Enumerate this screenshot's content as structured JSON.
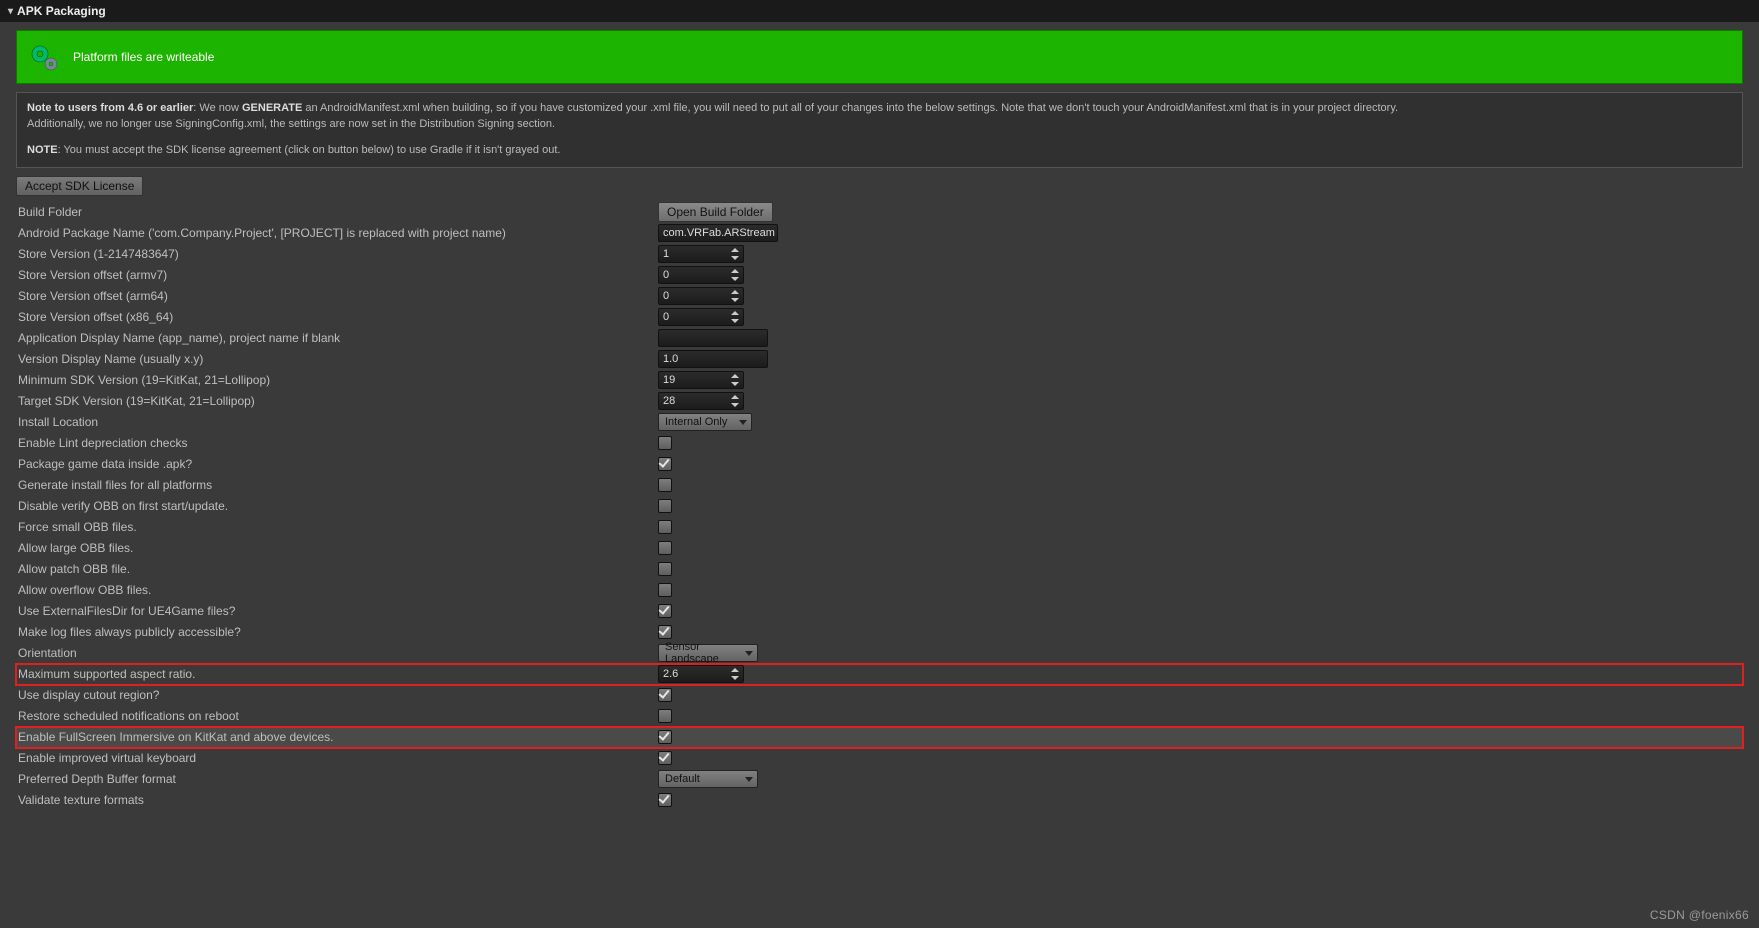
{
  "header": {
    "title": "APK Packaging"
  },
  "banner": {
    "msg": "Platform files are writeable"
  },
  "note": {
    "line1_strong": "Note to users from 4.6 or earlier",
    "line1_mid": ": We now ",
    "line1_gen": "GENERATE",
    "line1_rest": " an AndroidManifest.xml when building, so if you have customized your .xml file, you will need to put all of your changes into the below settings. Note that we don't touch your AndroidManifest.xml that is in your project directory.",
    "line2": "Additionally, we no longer use SigningConfig.xml, the settings are now set in the Distribution Signing section.",
    "line3_strong": "NOTE",
    "line3_rest": ": You must accept the SDK license agreement (click on button below) to use Gradle if it isn't grayed out."
  },
  "buttons": {
    "accept_sdk": "Accept SDK License",
    "open_build_folder": "Open Build Folder"
  },
  "fields": {
    "build_folder": "Build Folder",
    "pkg_name_label": "Android Package Name ('com.Company.Project', [PROJECT] is replaced with project name)",
    "pkg_name_value": "com.VRFab.ARStream",
    "store_ver_label": "Store Version (1-2147483647)",
    "store_ver_value": "1",
    "store_off_armv7_label": "Store Version offset (armv7)",
    "store_off_armv7_value": "0",
    "store_off_arm64_label": "Store Version offset (arm64)",
    "store_off_arm64_value": "0",
    "store_off_x86_64_label": "Store Version offset (x86_64)",
    "store_off_x86_64_value": "0",
    "app_display_label": "Application Display Name (app_name), project name if blank",
    "app_display_value": "",
    "ver_display_label": "Version Display Name (usually x.y)",
    "ver_display_value": "1.0",
    "min_sdk_label": "Minimum SDK Version (19=KitKat, 21=Lollipop)",
    "min_sdk_value": "19",
    "target_sdk_label": "Target SDK Version (19=KitKat, 21=Lollipop)",
    "target_sdk_value": "28",
    "install_loc_label": "Install Location",
    "install_loc_value": "Internal Only",
    "lint_label": "Enable Lint depreciation checks",
    "pack_apk_label": "Package game data inside .apk?",
    "gen_install_label": "Generate install files for all platforms",
    "disable_obb_label": "Disable verify OBB on first start/update.",
    "force_small_obb_label": "Force small OBB files.",
    "allow_large_obb_label": "Allow large OBB files.",
    "allow_patch_obb_label": "Allow patch OBB file.",
    "allow_overflow_obb_label": "Allow overflow OBB files.",
    "ext_files_label": "Use ExternalFilesDir for UE4Game files?",
    "log_public_label": "Make log files always publicly accessible?",
    "orientation_label": "Orientation",
    "orientation_value": "Sensor Landscape",
    "max_aspect_label": "Maximum supported aspect ratio.",
    "max_aspect_value": "2.6",
    "cutout_label": "Use display cutout region?",
    "restore_notif_label": "Restore scheduled notifications on reboot",
    "fullscreen_label": "Enable FullScreen Immersive on KitKat and above devices.",
    "improved_kb_label": "Enable improved virtual keyboard",
    "depth_buf_label": "Preferred Depth Buffer format",
    "depth_buf_value": "Default",
    "validate_tex_label": "Validate texture formats"
  },
  "checks": {
    "lint": false,
    "pack_apk": true,
    "gen_install": false,
    "disable_obb": false,
    "force_small_obb": false,
    "allow_large_obb": false,
    "allow_patch_obb": false,
    "allow_overflow_obb": false,
    "ext_files": true,
    "log_public": true,
    "cutout": true,
    "restore_notif": false,
    "fullscreen": true,
    "improved_kb": true,
    "validate_tex": true
  },
  "watermark": "CSDN @foenix66"
}
